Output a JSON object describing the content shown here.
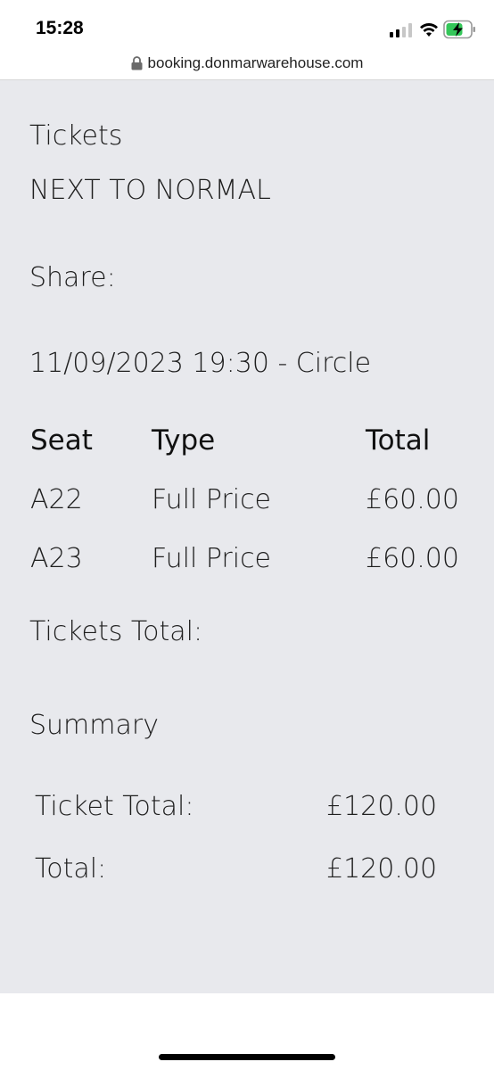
{
  "status_bar": {
    "time": "15:28"
  },
  "browser": {
    "url": "booking.donmarwarehouse.com"
  },
  "page": {
    "tickets_heading": "Tickets",
    "show_title": "NEXT TO NORMAL",
    "share_label": "Share:",
    "performance": "11/09/2023 19:30 - Circle",
    "table": {
      "headers": [
        "Seat",
        "Type",
        "Total"
      ],
      "rows": [
        {
          "seat": "A22",
          "type": "Full Price",
          "total": "£60.00"
        },
        {
          "seat": "A23",
          "type": "Full Price",
          "total": "£60.00"
        }
      ]
    },
    "tickets_total_label": "Tickets Total:",
    "summary_heading": "Summary",
    "summary": {
      "ticket_total_label": "Ticket Total:",
      "ticket_total_value": "£120.00",
      "total_label": "Total:",
      "total_value": "£120.00"
    }
  }
}
